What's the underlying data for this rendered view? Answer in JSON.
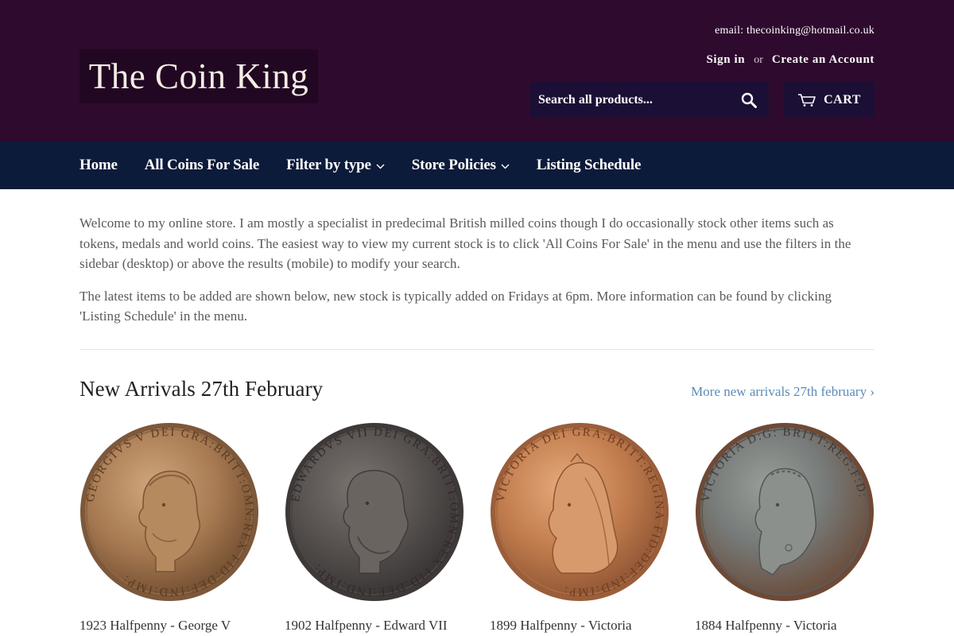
{
  "header": {
    "logo_text": "The Coin King",
    "email_text": "email: thecoinking@hotmail.co.uk",
    "sign_in": "Sign in",
    "or": "or",
    "create_account": "Create an Account",
    "search_placeholder": "Search all products...",
    "cart_label": "CART",
    "search_icon": "search-icon",
    "cart_icon": "cart-icon"
  },
  "nav": {
    "items": [
      {
        "label": "Home",
        "dropdown": false
      },
      {
        "label": "All Coins For Sale",
        "dropdown": false
      },
      {
        "label": "Filter by type",
        "dropdown": true
      },
      {
        "label": "Store Policies",
        "dropdown": true
      },
      {
        "label": "Listing Schedule",
        "dropdown": false
      }
    ]
  },
  "intro": {
    "p1": "Welcome to my online store. I am mostly a specialist in predecimal British milled coins though I do occasionally stock other items such as tokens, medals and world coins. The easiest way to view my current stock is to click 'All Coins For Sale' in the menu and use the filters in the sidebar (desktop) or above the results (mobile) to modify your search.",
    "p2": "The latest items to be added are shown below, new stock is typically added on Fridays at 6pm. More information can be found by clicking 'Listing Schedule' in the menu."
  },
  "section": {
    "title": "New Arrivals 27th February",
    "more_link": "More new arrivals 27th february ›"
  },
  "products": [
    {
      "title": "1923 Halfpenny - George V"
    },
    {
      "title": "1902 Halfpenny - Edward VII"
    },
    {
      "title": "1899 Halfpenny - Victoria"
    },
    {
      "title": "1884 Halfpenny - Victoria"
    }
  ],
  "colors": {
    "header_bg": "#2e0a2e",
    "nav_bg": "#0d1b3a",
    "search_bg": "#1c0f35",
    "link": "#5c8bb8"
  }
}
